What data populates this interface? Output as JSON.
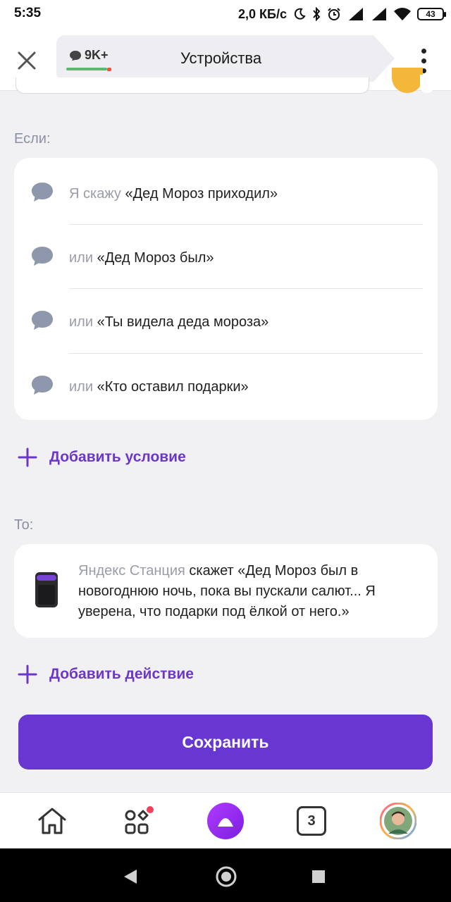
{
  "status_bar": {
    "time": "5:35",
    "speed": "2,0 КБ/с",
    "battery": "43",
    "icons": [
      "moon-icon",
      "bluetooth-icon",
      "alarm-icon",
      "signal-icon",
      "signal-icon",
      "wifi-icon",
      "battery-icon"
    ]
  },
  "header": {
    "title": "Устройства",
    "badge": "9K+",
    "close_icon": "close-icon",
    "more_icon": "more-vertical-icon"
  },
  "if_section": {
    "label": "Если:",
    "conditions": [
      {
        "prefix": "Я скажу",
        "phrase": "«Дед Мороз приходил»"
      },
      {
        "prefix": "или",
        "phrase": "«Дед Мороз был»"
      },
      {
        "prefix": "или",
        "phrase": "«Ты видела деда мороза»"
      },
      {
        "prefix": "или",
        "phrase": "«Кто оставил подарки»"
      }
    ],
    "add_label": "Добавить условие"
  },
  "then_section": {
    "label": "То:",
    "action": {
      "device": "Яндекс Станция",
      "text": " скажет «Дед Мороз был в новогоднюю ночь, пока вы пускали салют... Я уверена, что подарки под ёлкой от него.»"
    },
    "add_label": "Добавить действие"
  },
  "save_label": "Сохранить",
  "tab_bar": {
    "devices_count": "3",
    "icons": [
      "home-icon",
      "services-icon",
      "alice-icon",
      "devices-count-icon",
      "avatar"
    ]
  },
  "colors": {
    "accent": "#6836d0",
    "link": "#6b37c9",
    "background": "#f1f1f4",
    "muted_text": "#9a9ca8"
  }
}
